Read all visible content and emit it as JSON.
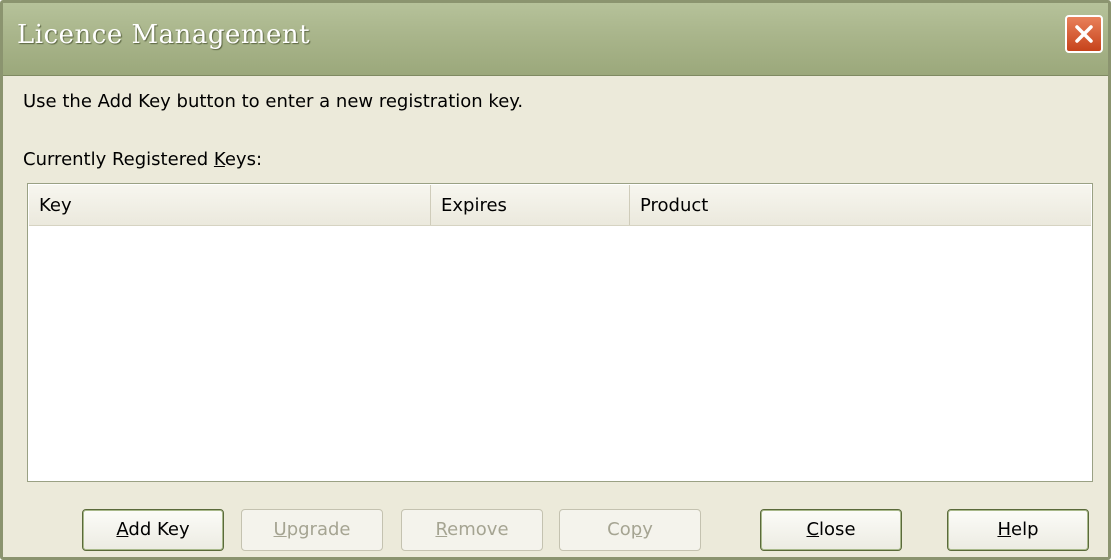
{
  "window": {
    "title": "Licence Management"
  },
  "content": {
    "instruction": "Use the Add Key button to enter a new registration key.",
    "registered_label_prefix": "Currently Registered ",
    "registered_label_accel": "K",
    "registered_label_suffix": "eys:"
  },
  "table": {
    "columns": [
      "Key",
      "Expires",
      "Product"
    ],
    "rows": []
  },
  "buttons": {
    "add_key": {
      "accel": "A",
      "rest": "dd Key",
      "enabled": true
    },
    "upgrade": {
      "accel": "U",
      "rest": "pgrade",
      "enabled": false
    },
    "remove": {
      "accel": "R",
      "rest": "emove",
      "enabled": false
    },
    "copy": {
      "prefix": "Co",
      "accel": "p",
      "rest": "y",
      "enabled": false
    },
    "close": {
      "accel": "C",
      "rest": "lose",
      "enabled": true
    },
    "help": {
      "accel": "H",
      "rest": "elp",
      "enabled": true
    }
  },
  "icons": {
    "close_window": "close-x-icon"
  },
  "colors": {
    "titlebar": "#a9b58b",
    "window_bg": "#eceada",
    "close_button": "#d25a30"
  }
}
